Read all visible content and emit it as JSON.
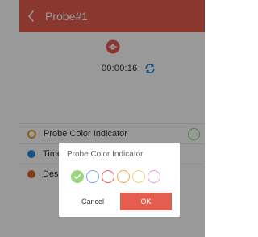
{
  "appbar": {
    "title": "Probe#1",
    "back_icon": "chevron-left-icon"
  },
  "timer": {
    "value": "00:00:16",
    "refresh_icon": "refresh-icon"
  },
  "list": {
    "items": [
      {
        "label": "Probe Color Indicator",
        "icon_color": "#f0a020"
      },
      {
        "label": "Time",
        "icon_color": "#2a8ad6"
      },
      {
        "label": "Desi",
        "icon_color": "#e06a2a"
      }
    ]
  },
  "dialog": {
    "title": "Probe Color Indicator",
    "colors": [
      "#9ed47e",
      "#7aa6e6",
      "#f05a5a",
      "#f5a64a",
      "#f3d56a",
      "#e89bd6"
    ],
    "selected_index": 0,
    "cancel_label": "Cancel",
    "ok_label": "OK"
  },
  "theme": {
    "accent": "#e45d4f",
    "indicator_color": "#8bd06a"
  }
}
